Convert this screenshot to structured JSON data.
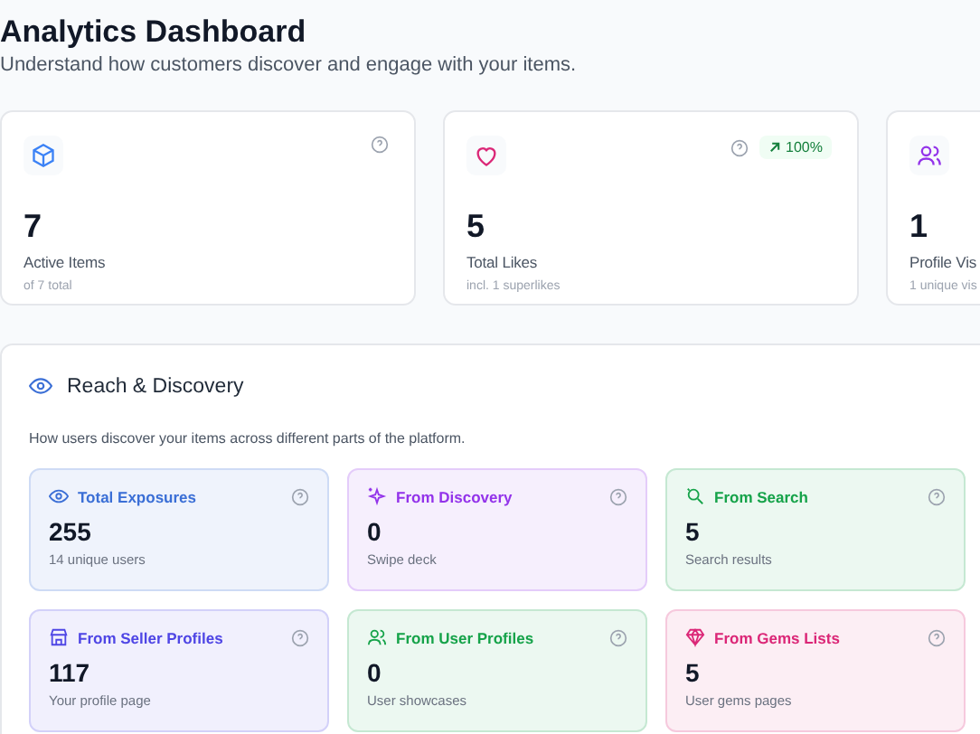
{
  "header": {
    "title": "Analytics Dashboard",
    "subtitle": "Understand how customers discover and engage with your items."
  },
  "stats": [
    {
      "kind": "items",
      "value": "7",
      "label": "Active Items",
      "note": "of 7 total"
    },
    {
      "kind": "likes",
      "value": "5",
      "label": "Total Likes",
      "note": "incl. 1 superlikes",
      "badge": "100%"
    },
    {
      "kind": "visits",
      "value": "1",
      "label": "Profile Vis",
      "note": "1 unique vis"
    }
  ],
  "reach": {
    "title": "Reach & Discovery",
    "description": "How users discover your items across different parts of the platform.",
    "tiles": [
      {
        "kind": "exposures",
        "color": "#3b6fd6",
        "title": "Total Exposures",
        "value": "255",
        "note": "14 unique users"
      },
      {
        "kind": "discovery",
        "color": "#9333ea",
        "title": "From Discovery",
        "value": "0",
        "note": "Swipe deck"
      },
      {
        "kind": "search",
        "color": "#16a34a",
        "title": "From Search",
        "value": "5",
        "note": "Search results"
      },
      {
        "kind": "sellers",
        "color": "#4f46e5",
        "title": "From Seller Profiles",
        "value": "117",
        "note": "Your profile page"
      },
      {
        "kind": "users",
        "color": "#16a34a",
        "title": "From User Profiles",
        "value": "0",
        "note": "User showcases"
      },
      {
        "kind": "gems",
        "color": "#db2777",
        "title": "From Gems Lists",
        "value": "5",
        "note": "User gems pages"
      }
    ]
  }
}
